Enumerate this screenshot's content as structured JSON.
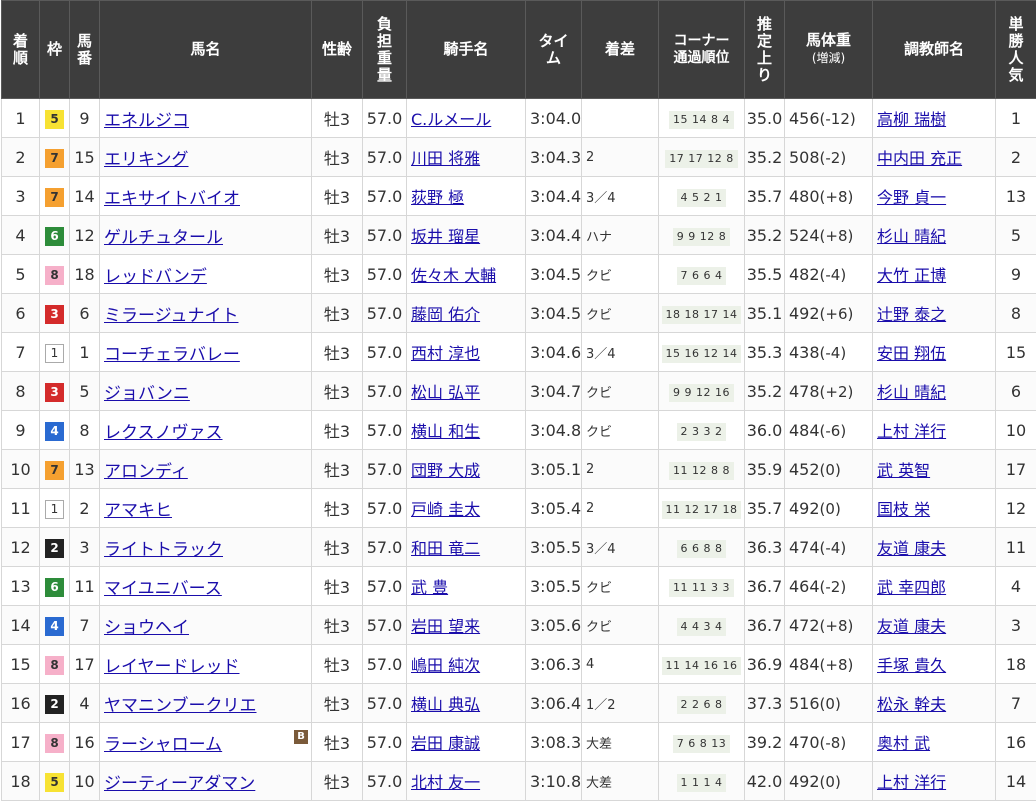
{
  "headers": {
    "rank": [
      "着",
      "順"
    ],
    "waku": [
      "枠"
    ],
    "umaban": [
      "馬",
      "番"
    ],
    "horse": [
      "馬名"
    ],
    "sexage": [
      "性齢"
    ],
    "weight": [
      "負",
      "担",
      "重",
      "量"
    ],
    "jockey": [
      "騎手名"
    ],
    "time": [
      "タイ",
      "ム"
    ],
    "margin": [
      "着差"
    ],
    "corner": [
      "コーナー",
      "通過順位"
    ],
    "last3f": [
      "推",
      "定",
      "上",
      "り"
    ],
    "body": [
      "馬体重",
      "(増減)"
    ],
    "trainer": [
      "調教師名"
    ],
    "pop": [
      "単",
      "勝",
      "人",
      "気"
    ]
  },
  "rows": [
    {
      "rank": "1",
      "waku": "5",
      "umaban": "9",
      "horse": "エネルジコ",
      "blinker": "",
      "sexage": "牡3",
      "weight": "57.0",
      "jockey": "C.ルメール",
      "time": "3:04.0",
      "margin": "",
      "corner": "15 14 8 4",
      "last3f": "35.0",
      "body": "456",
      "change": "(-12)",
      "trainer": "高柳 瑞樹",
      "pop": "1"
    },
    {
      "rank": "2",
      "waku": "7",
      "umaban": "15",
      "horse": "エリキング",
      "blinker": "",
      "sexage": "牡3",
      "weight": "57.0",
      "jockey": "川田 将雅",
      "time": "3:04.3",
      "margin": "2",
      "corner": "17 17 12 8",
      "last3f": "35.2",
      "body": "508",
      "change": "(-2)",
      "trainer": "中内田 充正",
      "pop": "2"
    },
    {
      "rank": "3",
      "waku": "7",
      "umaban": "14",
      "horse": "エキサイトバイオ",
      "blinker": "",
      "sexage": "牡3",
      "weight": "57.0",
      "jockey": "荻野 極",
      "time": "3:04.4",
      "margin": "3／4",
      "corner": "4 5 2 1",
      "last3f": "35.7",
      "body": "480",
      "change": "(+8)",
      "trainer": "今野 貞一",
      "pop": "13"
    },
    {
      "rank": "4",
      "waku": "6",
      "umaban": "12",
      "horse": "ゲルチュタール",
      "blinker": "",
      "sexage": "牡3",
      "weight": "57.0",
      "jockey": "坂井 瑠星",
      "time": "3:04.4",
      "margin": "ハナ",
      "corner": "9 9 12 8",
      "last3f": "35.2",
      "body": "524",
      "change": "(+8)",
      "trainer": "杉山 晴紀",
      "pop": "5"
    },
    {
      "rank": "5",
      "waku": "8",
      "umaban": "18",
      "horse": "レッドバンデ",
      "blinker": "",
      "sexage": "牡3",
      "weight": "57.0",
      "jockey": "佐々木 大輔",
      "time": "3:04.5",
      "margin": "クビ",
      "corner": "7 6 6 4",
      "last3f": "35.5",
      "body": "482",
      "change": "(-4)",
      "trainer": "大竹 正博",
      "pop": "9"
    },
    {
      "rank": "6",
      "waku": "3",
      "umaban": "6",
      "horse": "ミラージュナイト",
      "blinker": "",
      "sexage": "牡3",
      "weight": "57.0",
      "jockey": "藤岡 佑介",
      "time": "3:04.5",
      "margin": "クビ",
      "corner": "18 18 17 14",
      "last3f": "35.1",
      "body": "492",
      "change": "(+6)",
      "trainer": "辻野 泰之",
      "pop": "8"
    },
    {
      "rank": "7",
      "waku": "1",
      "umaban": "1",
      "horse": "コーチェラバレー",
      "blinker": "",
      "sexage": "牡3",
      "weight": "57.0",
      "jockey": "西村 淳也",
      "time": "3:04.6",
      "margin": "3／4",
      "corner": "15 16 12 14",
      "last3f": "35.3",
      "body": "438",
      "change": "(-4)",
      "trainer": "安田 翔伍",
      "pop": "15"
    },
    {
      "rank": "8",
      "waku": "3",
      "umaban": "5",
      "horse": "ジョバンニ",
      "blinker": "",
      "sexage": "牡3",
      "weight": "57.0",
      "jockey": "松山 弘平",
      "time": "3:04.7",
      "margin": "クビ",
      "corner": "9 9 12 16",
      "last3f": "35.2",
      "body": "478",
      "change": "(+2)",
      "trainer": "杉山 晴紀",
      "pop": "6"
    },
    {
      "rank": "9",
      "waku": "4",
      "umaban": "8",
      "horse": "レクスノヴァス",
      "blinker": "",
      "sexage": "牡3",
      "weight": "57.0",
      "jockey": "横山 和生",
      "time": "3:04.8",
      "margin": "クビ",
      "corner": "2 3 3 2",
      "last3f": "36.0",
      "body": "484",
      "change": "(-6)",
      "trainer": "上村 洋行",
      "pop": "10"
    },
    {
      "rank": "10",
      "waku": "7",
      "umaban": "13",
      "horse": "アロンディ",
      "blinker": "",
      "sexage": "牡3",
      "weight": "57.0",
      "jockey": "団野 大成",
      "time": "3:05.1",
      "margin": "2",
      "corner": "11 12 8 8",
      "last3f": "35.9",
      "body": "452",
      "change": "(0)",
      "trainer": "武 英智",
      "pop": "17"
    },
    {
      "rank": "11",
      "waku": "1",
      "umaban": "2",
      "horse": "アマキヒ",
      "blinker": "",
      "sexage": "牡3",
      "weight": "57.0",
      "jockey": "戸崎 圭太",
      "time": "3:05.4",
      "margin": "2",
      "corner": "11 12 17 18",
      "last3f": "35.7",
      "body": "492",
      "change": "(0)",
      "trainer": "国枝 栄",
      "pop": "12"
    },
    {
      "rank": "12",
      "waku": "2",
      "umaban": "3",
      "horse": "ライトトラック",
      "blinker": "",
      "sexage": "牡3",
      "weight": "57.0",
      "jockey": "和田 竜二",
      "time": "3:05.5",
      "margin": "3／4",
      "corner": "6 6 8 8",
      "last3f": "36.3",
      "body": "474",
      "change": "(-4)",
      "trainer": "友道 康夫",
      "pop": "11"
    },
    {
      "rank": "13",
      "waku": "6",
      "umaban": "11",
      "horse": "マイユニバース",
      "blinker": "",
      "sexage": "牡3",
      "weight": "57.0",
      "jockey": "武 豊",
      "time": "3:05.5",
      "margin": "クビ",
      "corner": "11 11 3 3",
      "last3f": "36.7",
      "body": "464",
      "change": "(-2)",
      "trainer": "武 幸四郎",
      "pop": "4"
    },
    {
      "rank": "14",
      "waku": "4",
      "umaban": "7",
      "horse": "ショウヘイ",
      "blinker": "",
      "sexage": "牡3",
      "weight": "57.0",
      "jockey": "岩田 望来",
      "time": "3:05.6",
      "margin": "クビ",
      "corner": "4 4 3 4",
      "last3f": "36.7",
      "body": "472",
      "change": "(+8)",
      "trainer": "友道 康夫",
      "pop": "3"
    },
    {
      "rank": "15",
      "waku": "8",
      "umaban": "17",
      "horse": "レイヤードレッド",
      "blinker": "",
      "sexage": "牡3",
      "weight": "57.0",
      "jockey": "嶋田 純次",
      "time": "3:06.3",
      "margin": "4",
      "corner": "11 14 16 16",
      "last3f": "36.9",
      "body": "484",
      "change": "(+8)",
      "trainer": "手塚 貴久",
      "pop": "18"
    },
    {
      "rank": "16",
      "waku": "2",
      "umaban": "4",
      "horse": "ヤマニンブークリエ",
      "blinker": "",
      "sexage": "牡3",
      "weight": "57.0",
      "jockey": "横山 典弘",
      "time": "3:06.4",
      "margin": "1／2",
      "corner": "2 2 6 8",
      "last3f": "37.3",
      "body": "516",
      "change": "(0)",
      "trainer": "松永 幹夫",
      "pop": "7"
    },
    {
      "rank": "17",
      "waku": "8",
      "umaban": "16",
      "horse": "ラーシャローム",
      "blinker": "B",
      "sexage": "牡3",
      "weight": "57.0",
      "jockey": "岩田 康誠",
      "time": "3:08.3",
      "margin": "大差",
      "corner": "7 6 8 13",
      "last3f": "39.2",
      "body": "470",
      "change": "(-8)",
      "trainer": "奥村 武",
      "pop": "16"
    },
    {
      "rank": "18",
      "waku": "5",
      "umaban": "10",
      "horse": "ジーティーアダマン",
      "blinker": "",
      "sexage": "牡3",
      "weight": "57.0",
      "jockey": "北村 友一",
      "time": "3:10.8",
      "margin": "大差",
      "corner": "1 1 1 4",
      "last3f": "42.0",
      "body": "492",
      "change": "(0)",
      "trainer": "上村 洋行",
      "pop": "14"
    }
  ]
}
